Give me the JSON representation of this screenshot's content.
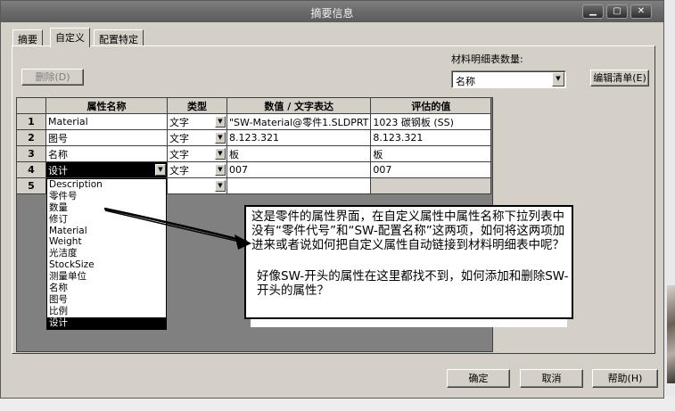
{
  "window": {
    "title": "摘要信息"
  },
  "tabs": [
    {
      "label": "摘要"
    },
    {
      "label": "自定义"
    },
    {
      "label": "配置特定"
    }
  ],
  "toolbar": {
    "delete_label": "删除(D)",
    "bom_qty_label": "材料明细表数量:",
    "bom_qty_value": "名称",
    "edit_list_label": "编辑清单(E)"
  },
  "grid": {
    "headers": [
      "属性名称",
      "类型",
      "数值 / 文字表达",
      "评估的值"
    ],
    "rows": [
      {
        "num": "1",
        "name": "Material",
        "type": "文字",
        "value": "\"SW-Material@零件1.SLDPRT",
        "evaluated": "1023 碳钢板 (SS)"
      },
      {
        "num": "2",
        "name": "图号",
        "type": "文字",
        "value": "8.123.321",
        "evaluated": "8.123.321"
      },
      {
        "num": "3",
        "name": "名称",
        "type": "文字",
        "value": "板",
        "evaluated": "板"
      },
      {
        "num": "4",
        "name": "设计",
        "type": "文字",
        "value": "007",
        "evaluated": "007"
      },
      {
        "num": "5",
        "name": "",
        "type": "",
        "value": "",
        "evaluated": ""
      }
    ]
  },
  "dropdown_options": [
    "Description",
    "零件号",
    "数量",
    "修订",
    "Material",
    "Weight",
    "光洁度",
    "StockSize",
    "测量单位",
    "名称",
    "图号",
    "比例",
    "设计"
  ],
  "callout": {
    "main": "这是零件的属性界面，在自定义属性中属性名称下拉列表中没有“零件代号”和“SW-配置名称”这两项，如何将这两项加进来或者说如何把自定义属性自动链接到材料明细表中呢？",
    "sub": "好像SW-开头的属性在这里都找不到，如何添加和删除SW-开头的属性？"
  },
  "footer": {
    "ok_label": "确定",
    "cancel_label": "取消",
    "help_label": "帮助(H)"
  },
  "icons": {
    "minimize": "minimize-icon",
    "maximize": "maximize-icon",
    "close": "close-icon",
    "dropdown": "chevron-down-icon"
  }
}
